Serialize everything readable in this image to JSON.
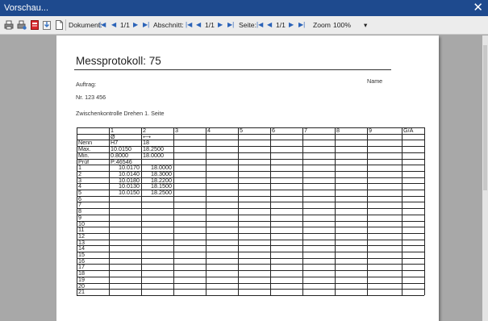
{
  "window": {
    "title": "Vorschau...",
    "close_glyph": "✕"
  },
  "toolbar": {
    "icons": [
      "print-icon",
      "print-setup-icon",
      "pdf-export-icon",
      "export-icon",
      "page-icon"
    ],
    "document": {
      "label": "Dokument:",
      "value": "1/1"
    },
    "section": {
      "label": "Abschnitt:",
      "value": "1/1"
    },
    "page": {
      "label": "Seite:",
      "value": "1/1"
    },
    "zoom": {
      "label": "Zoom",
      "value": "100%",
      "arrow": "▾"
    },
    "nav_glyphs": {
      "first": "|◀",
      "prev": "◀",
      "next": "▶",
      "last": "▶|"
    }
  },
  "report": {
    "title": "Messprotokoll:  75",
    "auftrag_label": "Auftrag:",
    "name_label": "Name",
    "nr": "Nr. 123 456",
    "subtitle": "Zwischenkontrolle Drehen 1. Seite",
    "table": {
      "column_headers": [
        "",
        "1",
        "2",
        "3",
        "4",
        "5",
        "6",
        "7",
        "8",
        "9",
        "G/A"
      ],
      "symbols": [
        "",
        "Ø",
        "⟷"
      ],
      "rows": [
        {
          "label": "Nenn",
          "c1": "H7",
          "c2": "18"
        },
        {
          "label": "Max.",
          "c1": "10.0150",
          "c2": "18.2500"
        },
        {
          "label": "Min.",
          "c1": "0.8000",
          "c2": "18.0000"
        },
        {
          "label": "Prüf",
          "c1": "P:46546",
          "c2": ""
        },
        {
          "label": "1",
          "c1": "10.0170",
          "c2": "18.0000"
        },
        {
          "label": "2",
          "c1": "10.0140",
          "c2": "18.3000"
        },
        {
          "label": "3",
          "c1": "10.0180",
          "c2": "18.2200"
        },
        {
          "label": "4",
          "c1": "10.0130",
          "c2": "18.1500"
        },
        {
          "label": "5",
          "c1": "10.0150",
          "c2": "18.2500"
        },
        {
          "label": "6",
          "c1": "",
          "c2": ""
        },
        {
          "label": "7",
          "c1": "",
          "c2": ""
        },
        {
          "label": "8",
          "c1": "",
          "c2": ""
        },
        {
          "label": "9",
          "c1": "",
          "c2": ""
        },
        {
          "label": "10",
          "c1": "",
          "c2": ""
        },
        {
          "label": "11",
          "c1": "",
          "c2": ""
        },
        {
          "label": "12",
          "c1": "",
          "c2": ""
        },
        {
          "label": "13",
          "c1": "",
          "c2": ""
        },
        {
          "label": "14",
          "c1": "",
          "c2": ""
        },
        {
          "label": "15",
          "c1": "",
          "c2": ""
        },
        {
          "label": "16",
          "c1": "",
          "c2": ""
        },
        {
          "label": "17",
          "c1": "",
          "c2": ""
        },
        {
          "label": "18",
          "c1": "",
          "c2": ""
        },
        {
          "label": "19",
          "c1": "",
          "c2": ""
        },
        {
          "label": "20",
          "c1": "",
          "c2": ""
        },
        {
          "label": "21",
          "c1": "",
          "c2": ""
        }
      ]
    }
  }
}
